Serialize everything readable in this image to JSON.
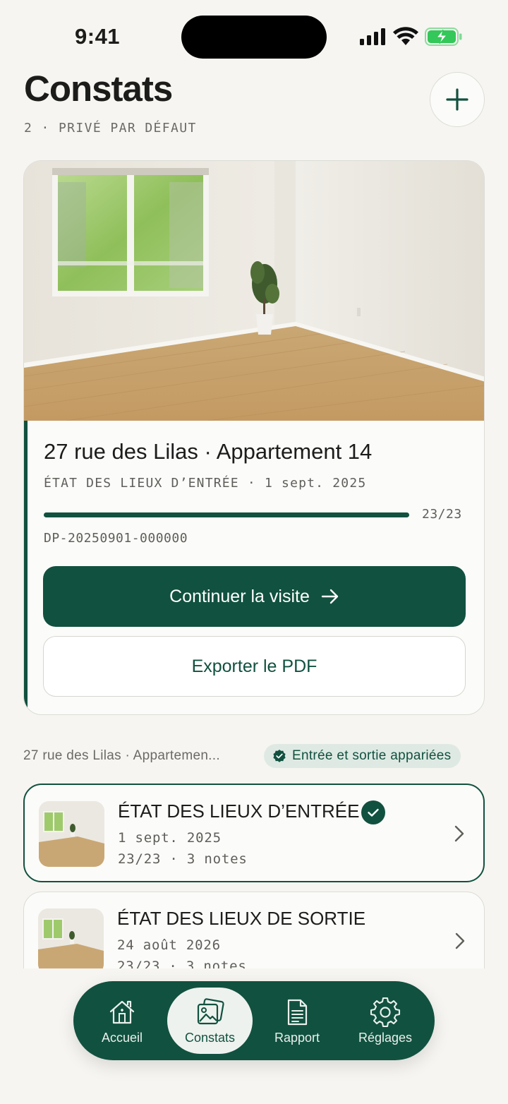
{
  "status_bar": {
    "time": "9:41"
  },
  "header": {
    "title": "Constats",
    "subtitle": "2 · PRIVÉ PAR DÉFAUT"
  },
  "main_card": {
    "title": "27 rue des Lilas · Appartement 14",
    "subtitle": "ÉTAT DES LIEUX D’ENTRÉE · 1 sept. 2025",
    "progress": {
      "done": 23,
      "total": 23,
      "label": "23/23",
      "fraction": 1.0
    },
    "reference": "DP-20250901-000000",
    "primary_button": "Continuer la visite",
    "secondary_button": "Exporter le PDF"
  },
  "pair": {
    "address": "27 rue des Lilas · Appartemen...",
    "badge": "Entrée et sortie appariées"
  },
  "inspections": [
    {
      "title": "ÉTAT DES LIEUX D’ENTRÉE",
      "date": "1 sept. 2025",
      "meta": "23/23 · 3 notes",
      "completed": true
    },
    {
      "title": "ÉTAT DES LIEUX DE SORTIE",
      "date": "24 août 2026",
      "meta": "23/23 · 3 notes",
      "completed": false
    }
  ],
  "tabs": [
    {
      "label": "Accueil",
      "icon": "home-icon"
    },
    {
      "label": "Constats",
      "icon": "photos-icon",
      "selected": true
    },
    {
      "label": "Rapport",
      "icon": "document-icon"
    },
    {
      "label": "Réglages",
      "icon": "gear-icon"
    }
  ],
  "colors": {
    "accent": "#11513f",
    "background": "#f6f5f1",
    "card": "#fbfbf9",
    "badge_bg": "#dfe9e3",
    "battery": "#34c759"
  }
}
